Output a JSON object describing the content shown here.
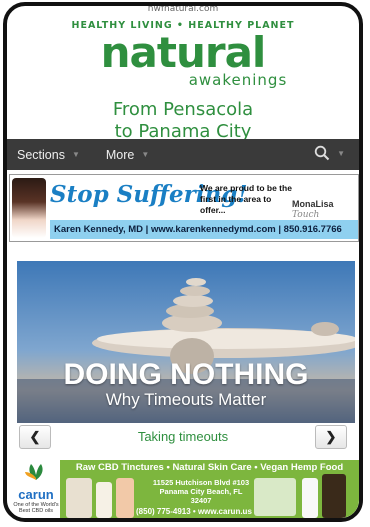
{
  "url": "nwfnatural.com",
  "masthead": {
    "tagline": "HEALTHY LIVING • HEALTHY PLANET",
    "logo_main": "natural",
    "logo_sub": "awakenings",
    "region": [
      "From Pensacola",
      "to Panama City"
    ]
  },
  "nav": {
    "items": [
      {
        "label": "Sections"
      },
      {
        "label": "More"
      }
    ],
    "search_icon": "search-icon"
  },
  "ad_top": {
    "headline": "Stop Suffering!",
    "proud": "We are proud to be the first in the area to offer...",
    "brand": "MonaLisa",
    "brand_script": "Touch",
    "contact": "Karen Kennedy, MD  |  www.karenkennedymd.com  |  850.916.7766"
  },
  "article": {
    "title": "DOING NOTHING",
    "subtitle": "Why Timeouts Matter",
    "caption": "Taking timeouts",
    "prev_icon": "chevron-left-icon",
    "next_icon": "chevron-right-icon"
  },
  "ad_bottom": {
    "logo": "carun",
    "logo_tag": "One of the World's Best CBD oils",
    "headline": "Raw CBD Tinctures • Natural Skin Care • Vegan Hemp Food",
    "address": [
      "11525 Hutchison Blvd #103",
      "Panama City Beach, FL 32407"
    ],
    "contact": "(850) 775-4913 • www.carun.us"
  },
  "colors": {
    "brand_green": "#2f8f3f",
    "nav_bg": "#3a3a3a",
    "ad_blue": "#1a7fc4",
    "ad_green": "#7db63e"
  }
}
